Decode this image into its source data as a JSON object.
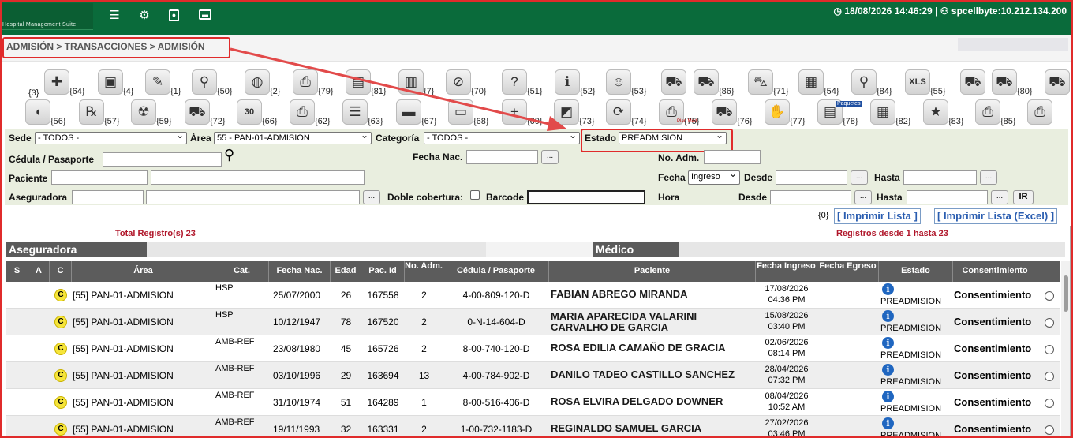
{
  "app": {
    "subtitle": "Hospital Management Suite"
  },
  "topbar": {
    "datetime": "18/08/2026 14:46:29",
    "user": "spcellbyte:10.212.134.200"
  },
  "breadcrumb": "ADMISIÓN > TRANSACCIONES > ADMISIÓN",
  "toolbar": {
    "row1": [
      {
        "icon": "first-aid-kit-icon",
        "glyph": "✚",
        "code": "{64}"
      },
      {
        "icon": "screen-icon",
        "glyph": "▣",
        "code": "{4}"
      },
      {
        "icon": "notepad-icon",
        "glyph": "✎",
        "code": "{1}"
      },
      {
        "icon": "magnifier-icon",
        "glyph": "⚲",
        "code": "{50}"
      },
      {
        "icon": "wristband-icon",
        "glyph": "◍",
        "code": "{2}"
      },
      {
        "icon": "printer-icon",
        "glyph": "⎙",
        "code": "{79}"
      },
      {
        "icon": "blurred-icon",
        "glyph": "▤",
        "code": "{81}"
      },
      {
        "icon": "barcode-icon",
        "glyph": "▥",
        "code": "{7}"
      },
      {
        "icon": "no-entry-icon",
        "glyph": "⊘",
        "code": "{70}"
      },
      {
        "icon": "question-refresh-icon",
        "glyph": "?",
        "code": "{51}"
      },
      {
        "icon": "info-form-icon",
        "glyph": "ℹ",
        "code": "{52}"
      },
      {
        "icon": "doctor-icon",
        "glyph": "☺",
        "code": "{53}"
      },
      {
        "icon": "basket-icon",
        "glyph": "⛟",
        "code": ""
      },
      {
        "icon": "basket-barcode-icon",
        "glyph": "⛟",
        "code": "{86}"
      },
      {
        "icon": "shopping-cart-icon",
        "glyph": "⛍",
        "code": "{71}"
      },
      {
        "icon": "box-icon",
        "glyph": "▦",
        "code": "{54}"
      },
      {
        "icon": "document-search-icon",
        "glyph": "⚲",
        "code": "{84}"
      },
      {
        "icon": "xls-icon",
        "glyph": "XLS",
        "code": "{55}"
      },
      {
        "icon": "basket-2-icon",
        "glyph": "⛟",
        "code": ""
      },
      {
        "icon": "basket-3-icon",
        "glyph": "⛟",
        "code": "{80}"
      },
      {
        "icon": "basket-4-icon",
        "glyph": "⛟",
        "code": ""
      }
    ],
    "row1_leading_code": "{3}",
    "row2": [
      {
        "icon": "pill-icon",
        "glyph": "◖",
        "code": "{56}"
      },
      {
        "icon": "rx-icon",
        "glyph": "℞",
        "code": "{57}"
      },
      {
        "icon": "radiation-icon",
        "glyph": "☢",
        "code": "{59}"
      },
      {
        "icon": "basket-5-icon",
        "glyph": "⛟",
        "code": "{72}"
      },
      {
        "icon": "calendar-icon",
        "glyph": "30",
        "code": "{66}"
      },
      {
        "icon": "scanner-icon",
        "glyph": "⎙",
        "code": "{62}"
      },
      {
        "icon": "chat-icon",
        "glyph": "☰",
        "code": "{63}"
      },
      {
        "icon": "bed-icon",
        "glyph": "▬",
        "code": "{67}"
      },
      {
        "icon": "monitor-icon",
        "glyph": "▭",
        "code": "{68}"
      },
      {
        "icon": "bed-add-icon",
        "glyph": "+",
        "code": "{69}"
      },
      {
        "icon": "box-3d-icon",
        "glyph": "◩",
        "code": "{73}"
      },
      {
        "icon": "recycle-icon",
        "glyph": "⟳",
        "code": "{74}"
      },
      {
        "icon": "plan-printer-icon",
        "glyph": "⎙",
        "code": "{75}"
      },
      {
        "icon": "basket-6-icon",
        "glyph": "⛟",
        "code": "{76}"
      },
      {
        "icon": "handshake-icon",
        "glyph": "✋",
        "code": "{77}"
      },
      {
        "icon": "packages-icon",
        "glyph": "▤",
        "code": "{78}"
      },
      {
        "icon": "box-arrow-icon",
        "glyph": "▦",
        "code": "{82}"
      },
      {
        "icon": "star-icon",
        "glyph": "★",
        "code": "{83}"
      },
      {
        "icon": "printer-2-icon",
        "glyph": "⎙",
        "code": "{85}"
      },
      {
        "icon": "printer-3-icon",
        "glyph": "⎙",
        "code": ""
      }
    ],
    "plan_med": "Plan Med.",
    "paquetes": "Paquetes"
  },
  "filters": {
    "sede_label": "Sede",
    "sede_value": "- TODOS -",
    "area_label": "Área",
    "area_value": "55 - PAN-01-ADMISION",
    "categoria_label": "Categoría",
    "categoria_value": "- TODOS -",
    "estado_label": "Estado",
    "estado_value": "PREADMISION",
    "cedula_label": "Cédula / Pasaporte",
    "fecha_nac_label": "Fecha Nac.",
    "no_adm_label": "No. Adm.",
    "paciente_label": "Paciente",
    "fecha_label": "Fecha",
    "fecha_value": "Ingreso",
    "desde_label": "Desde",
    "hasta_label": "Hasta",
    "aseguradora_label": "Aseguradora",
    "doble_label": "Doble cobertura:",
    "barcode_label": "Barcode",
    "hora_label": "Hora",
    "ir": "IR",
    "dots": "..."
  },
  "print": {
    "count": "{0}",
    "lista": "[ Imprimir Lista ]",
    "excel": "[ Imprimir Lista (Excel) ]"
  },
  "grid": {
    "total": "Total Registro(s) 23",
    "range": "Registros desde 1 hasta 23",
    "group_aseguradora": "Aseguradora",
    "group_medico": "Médico",
    "columns": [
      "S",
      "A",
      "C",
      "Área",
      "Cat.",
      "Fecha Nac.",
      "Edad",
      "Pac. Id",
      "No. Adm.",
      "Cédula / Pasaporte",
      "Paciente",
      "Fecha Ingreso",
      "Fecha Egreso",
      "Estado",
      "Consentimiento"
    ],
    "rows": [
      {
        "c": "C",
        "area": "[55] PAN-01-ADMISION",
        "cat": "HSP",
        "nac": "25/07/2000",
        "edad": "26",
        "pacid": "167558",
        "adm": "2",
        "ced": "4-00-809-120-D",
        "pac": "FABIAN ABREGO MIRANDA",
        "ing_d": "17/08/2026",
        "ing_t": "04:36 PM",
        "estado": "PREADMISION",
        "consent": "Consentimiento"
      },
      {
        "c": "C",
        "area": "[55] PAN-01-ADMISION",
        "cat": "HSP",
        "nac": "10/12/1947",
        "edad": "78",
        "pacid": "167520",
        "adm": "2",
        "ced": "0-N-14-604-D",
        "pac": "MARIA APARECIDA VALARINI CARVALHO DE GARCIA",
        "ing_d": "15/08/2026",
        "ing_t": "03:40 PM",
        "estado": "PREADMISION",
        "consent": "Consentimiento"
      },
      {
        "c": "C",
        "area": "[55] PAN-01-ADMISION",
        "cat": "AMB-REF",
        "nac": "23/08/1980",
        "edad": "45",
        "pacid": "165726",
        "adm": "2",
        "ced": "8-00-740-120-D",
        "pac": "ROSA EDILIA CAMAÑO DE GRACIA",
        "ing_d": "02/06/2026",
        "ing_t": "08:14 PM",
        "estado": "PREADMISION",
        "consent": "Consentimiento"
      },
      {
        "c": "C",
        "area": "[55] PAN-01-ADMISION",
        "cat": "AMB-REF",
        "nac": "03/10/1996",
        "edad": "29",
        "pacid": "163694",
        "adm": "13",
        "ced": "4-00-784-902-D",
        "pac": "DANILO TADEO CASTILLO SANCHEZ",
        "ing_d": "28/04/2026",
        "ing_t": "07:32 PM",
        "estado": "PREADMISION",
        "consent": "Consentimiento"
      },
      {
        "c": "C",
        "area": "[55] PAN-01-ADMISION",
        "cat": "AMB-REF",
        "nac": "31/10/1974",
        "edad": "51",
        "pacid": "164289",
        "adm": "1",
        "ced": "8-00-516-406-D",
        "pac": "ROSA ELVIRA DELGADO DOWNER",
        "ing_d": "08/04/2026",
        "ing_t": "10:52 AM",
        "estado": "PREADMISION",
        "consent": "Consentimiento"
      },
      {
        "c": "C",
        "area": "[55] PAN-01-ADMISION",
        "cat": "AMB-REF",
        "nac": "19/11/1993",
        "edad": "32",
        "pacid": "163331",
        "adm": "2",
        "ced": "1-00-732-1183-D",
        "pac": "REGINALDO SAMUEL GARCIA HOWARD",
        "ing_d": "27/02/2026",
        "ing_t": "03:46 PM",
        "estado": "PREADMISION",
        "consent": "Consentimiento"
      }
    ]
  }
}
